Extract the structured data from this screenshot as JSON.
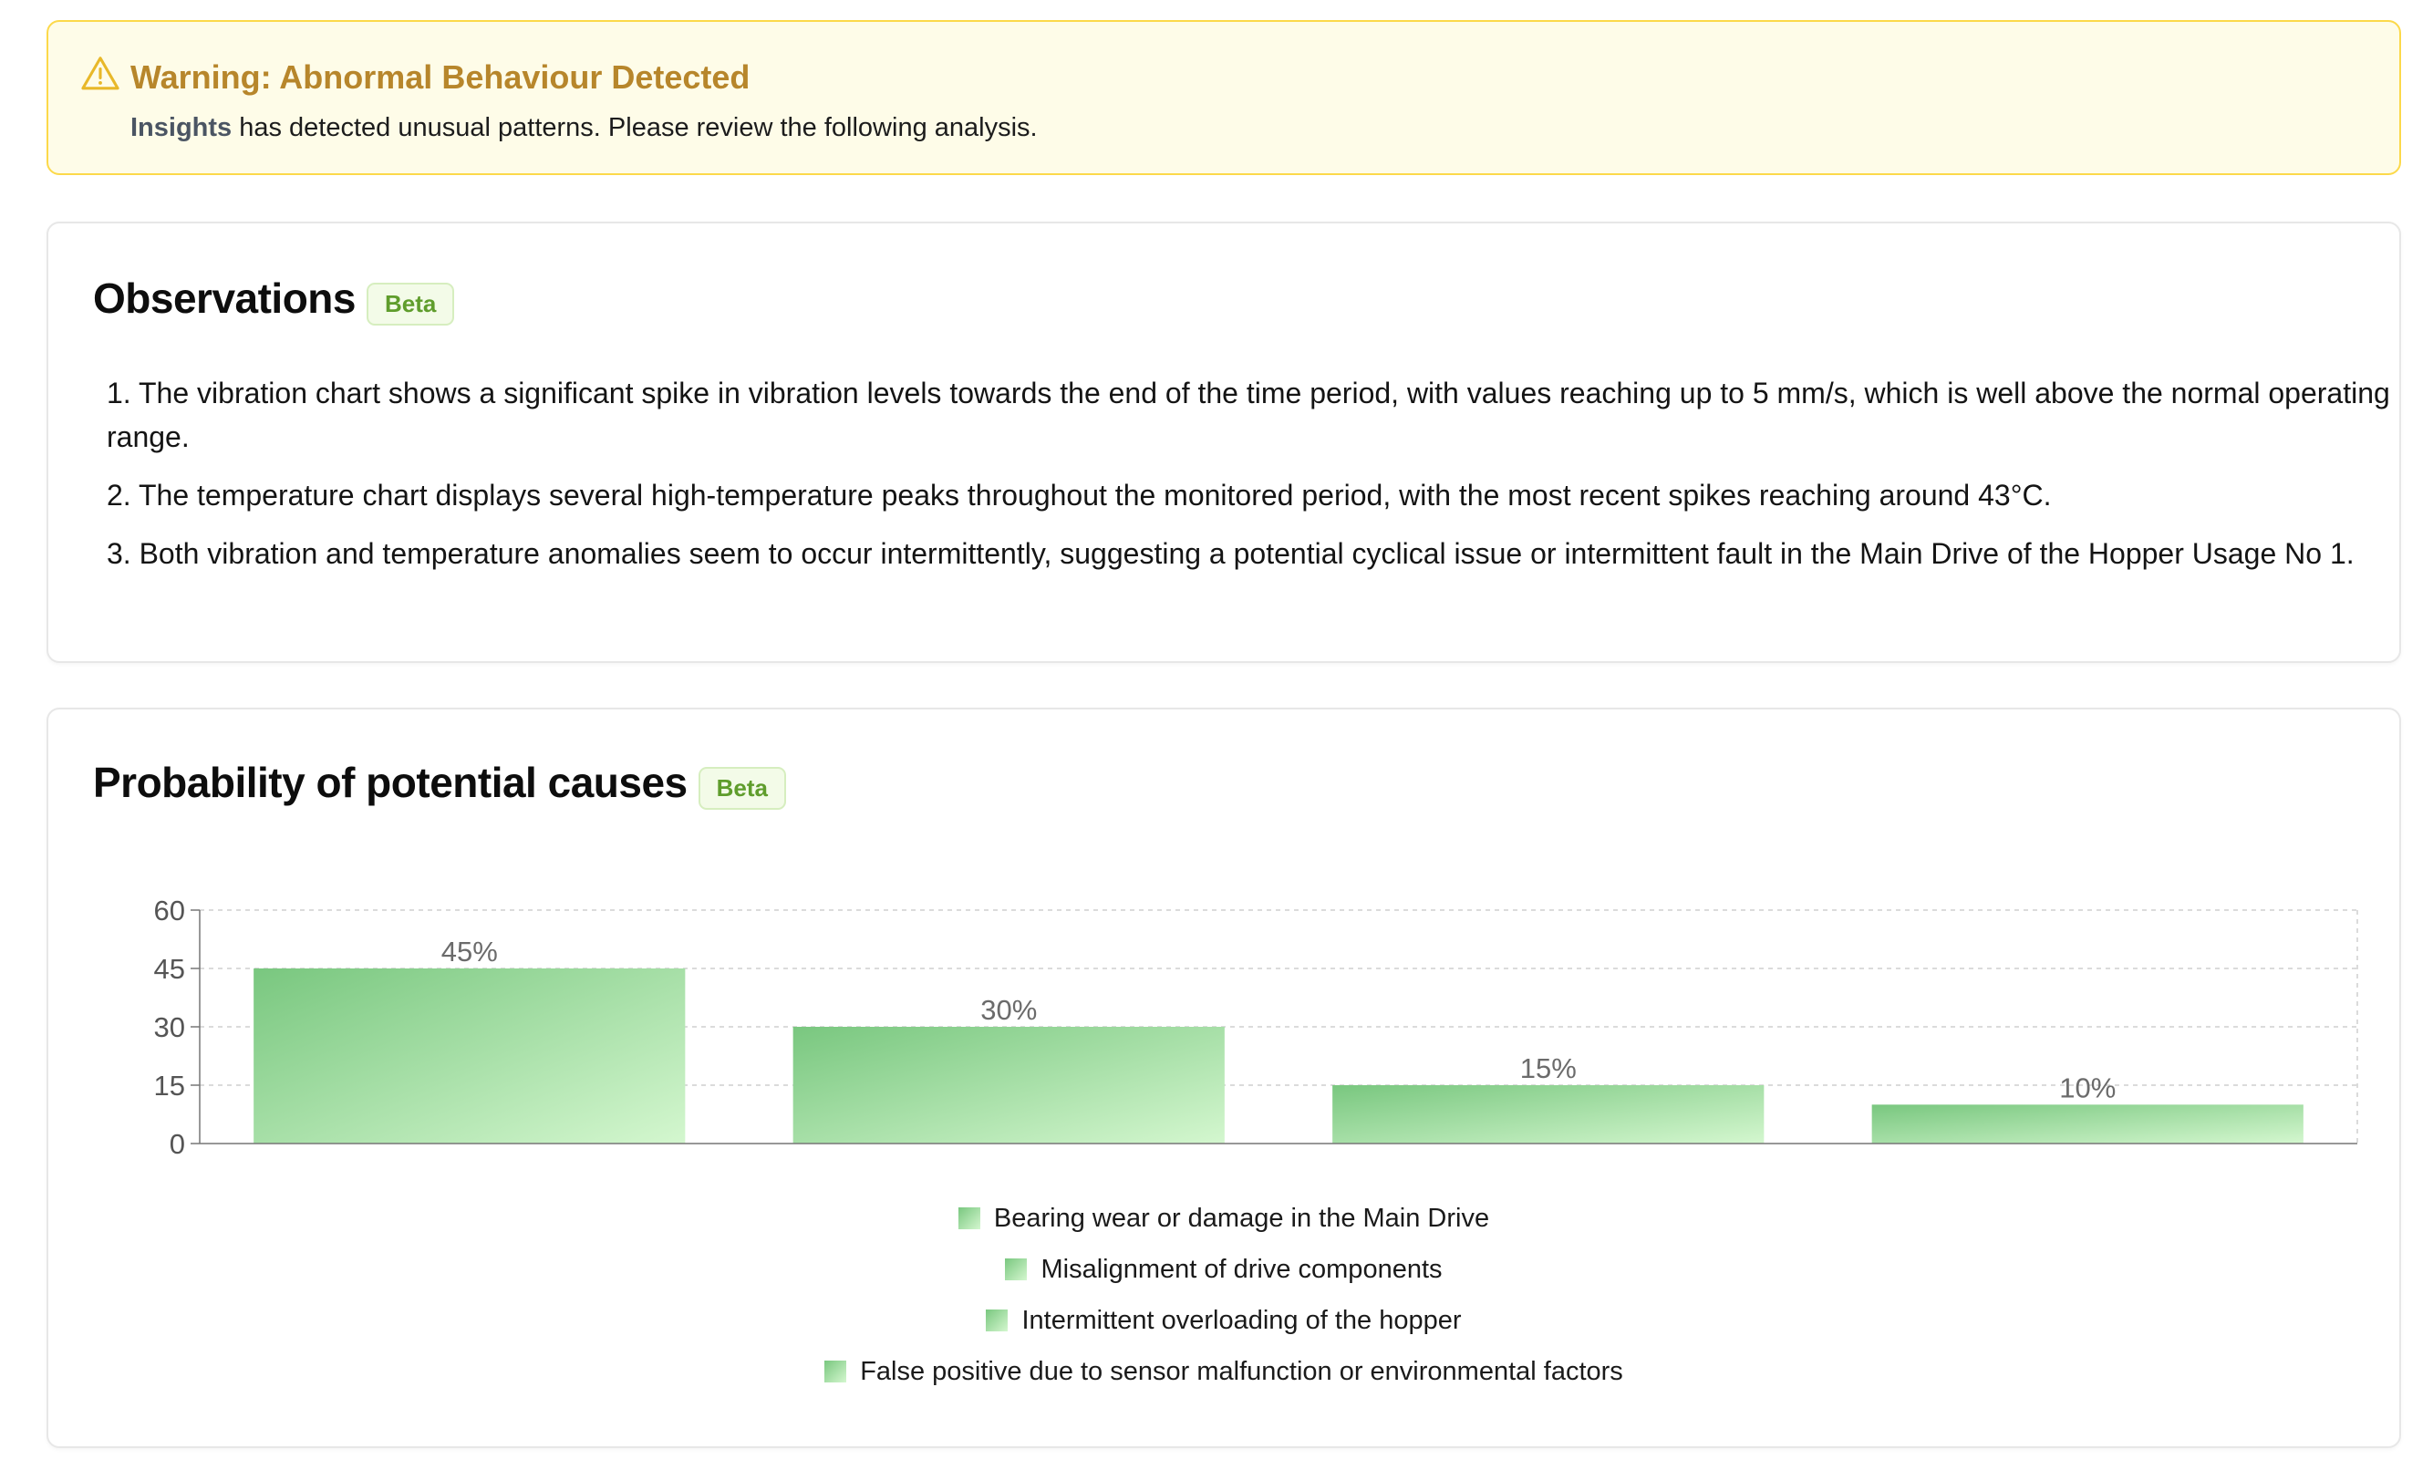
{
  "warning": {
    "icon": "warning-triangle-icon",
    "title": "Warning: Abnormal Behaviour Detected",
    "source_name": "Insights",
    "message": "has detected unusual patterns. Please review the following analysis."
  },
  "observations": {
    "title": "Observations",
    "badge": "Beta",
    "items": [
      "1. The vibration chart shows a significant spike in vibration levels towards the end of the time period, with values reaching up to 5 mm/s, which is well above the normal operating range.",
      "2. The temperature chart displays several high-temperature peaks throughout the monitored period, with the most recent spikes reaching around 43°C.",
      "3. Both vibration and temperature anomalies seem to occur intermittently, suggesting a potential cyclical issue or intermittent fault in the Main Drive of the Hopper Usage No 1."
    ]
  },
  "causes": {
    "title": "Probability of potential causes",
    "badge": "Beta"
  },
  "colors": {
    "warning_title": "#b7862b",
    "warning_border": "#fcd94a",
    "warning_bg": "#fefce8",
    "badge_text": "#5f9d2c",
    "bar_gradient_start": "#79c77f",
    "bar_gradient_end": "#d4f7cf"
  },
  "chart_data": {
    "type": "bar",
    "categories": [
      "Bearing wear or damage in the Main Drive",
      "Misalignment of drive components",
      "Intermittent overloading of the hopper",
      "False positive due to sensor malfunction or environmental factors"
    ],
    "values": [
      45,
      30,
      15,
      10
    ],
    "data_labels": [
      "45%",
      "30%",
      "15%",
      "10%"
    ],
    "yticks": [
      0,
      15,
      30,
      45,
      60
    ],
    "ylim": [
      0,
      60
    ],
    "grid": true,
    "legend_position": "bottom-center"
  }
}
